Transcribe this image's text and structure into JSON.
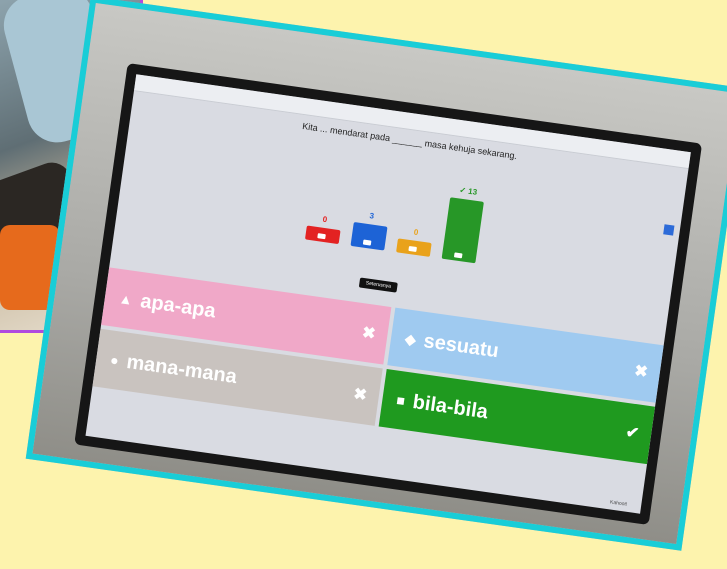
{
  "quiz": {
    "question": "Kita ... mendarat pada ______ masa kehuja sekarang.",
    "next_label": "Seterusnya",
    "footer": "Kahoot!",
    "results": [
      {
        "value": 0,
        "color": "#e32222",
        "symbol": "triangle"
      },
      {
        "value": 3,
        "color": "#1d63d6",
        "symbol": "diamond"
      },
      {
        "value": 0,
        "color": "#e9a21b",
        "symbol": "circle"
      },
      {
        "value": "✓ 13",
        "count": 13,
        "color": "#279727",
        "symbol": "square"
      }
    ],
    "answers": [
      {
        "label": "apa-apa",
        "shape": "▲",
        "mark": "✖",
        "color": "#f0a8c8"
      },
      {
        "label": "mana-mana",
        "shape": "●",
        "mark": "✖",
        "color": "#c9c3bf"
      },
      {
        "label": "sesuatu",
        "shape": "◆",
        "mark": "✖",
        "color": "#9fcaf0"
      },
      {
        "label": "bila-bila",
        "shape": "■",
        "mark": "✔",
        "color": "#1f9a1f"
      }
    ]
  }
}
